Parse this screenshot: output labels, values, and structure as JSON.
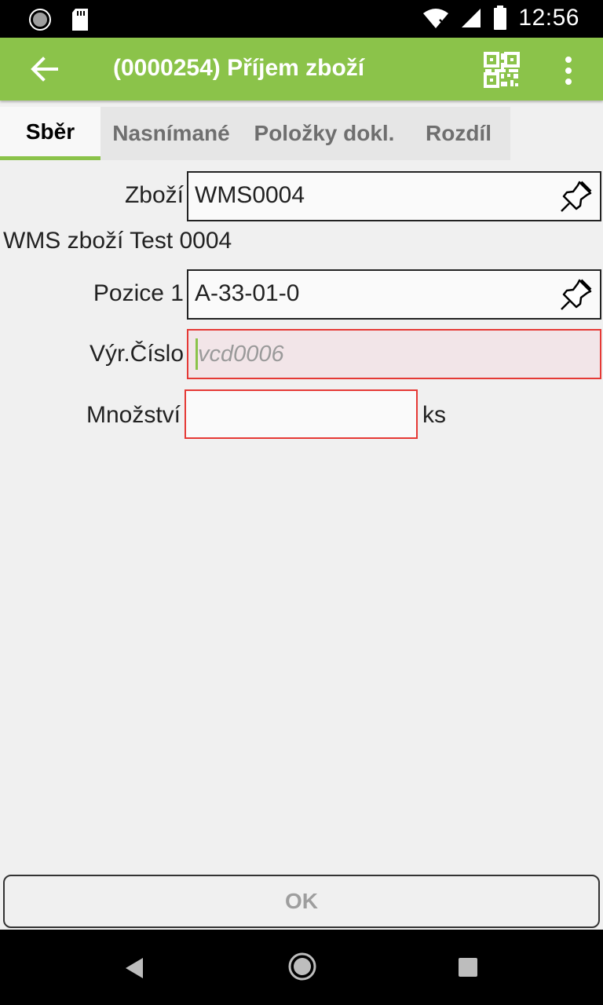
{
  "status_bar": {
    "time": "12:56"
  },
  "app_bar": {
    "title": "(0000254) Příjem zboží"
  },
  "tabs": [
    {
      "label": "Sběr"
    },
    {
      "label": "Nasnímané"
    },
    {
      "label": "Položky dokl."
    },
    {
      "label": "Rozdíl"
    }
  ],
  "form": {
    "item_label": "Zboží",
    "item_value": "WMS0004",
    "item_description": "WMS zboží Test 0004",
    "position_label": "Pozice 1",
    "position_value": "A-33-01-0",
    "serial_label": "Výr.Číslo",
    "serial_placeholder": "vcd0006",
    "quantity_label": "Množství",
    "quantity_value": "",
    "quantity_unit": "ks"
  },
  "buttons": {
    "ok_label": "OK"
  },
  "colors": {
    "accent": "#8bc34a",
    "error": "#e53935",
    "tab_bg": "#e6e6e6"
  }
}
